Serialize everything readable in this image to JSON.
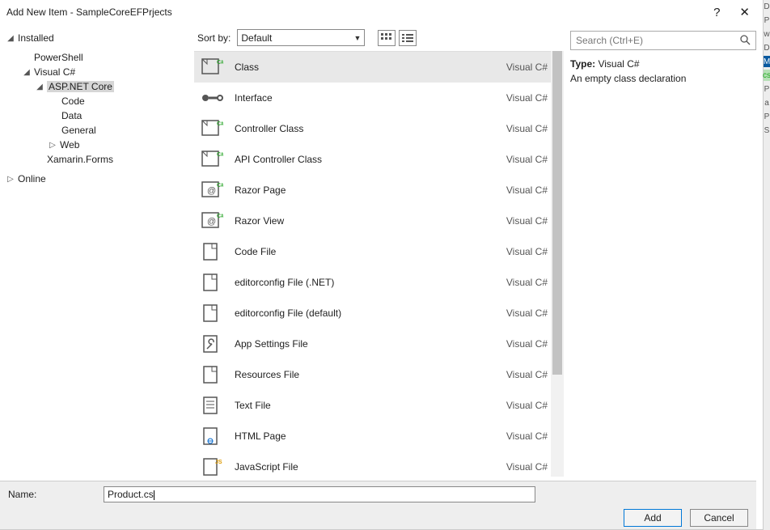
{
  "window": {
    "title": "Add New Item - SampleCoreEFPrjects",
    "help": "?",
    "close": "✕"
  },
  "tree": {
    "header": "Installed",
    "nodes": {
      "powershell": "PowerShell",
      "visualcs": "Visual C#",
      "aspnetcore": "ASP.NET Core",
      "code": "Code",
      "data": "Data",
      "general": "General",
      "web": "Web",
      "xamarin": "Xamarin.Forms",
      "online": "Online"
    }
  },
  "toolbar": {
    "sortby": "Sort by:",
    "sortvalue": "Default"
  },
  "search": {
    "placeholder": "Search (Ctrl+E)"
  },
  "templates": [
    {
      "name": "Class",
      "lang": "Visual C#",
      "selected": true
    },
    {
      "name": "Interface",
      "lang": "Visual C#"
    },
    {
      "name": "Controller Class",
      "lang": "Visual C#"
    },
    {
      "name": "API Controller Class",
      "lang": "Visual C#"
    },
    {
      "name": "Razor Page",
      "lang": "Visual C#"
    },
    {
      "name": "Razor View",
      "lang": "Visual C#"
    },
    {
      "name": "Code File",
      "lang": "Visual C#"
    },
    {
      "name": "editorconfig File (.NET)",
      "lang": "Visual C#"
    },
    {
      "name": "editorconfig File (default)",
      "lang": "Visual C#"
    },
    {
      "name": "App Settings File",
      "lang": "Visual C#"
    },
    {
      "name": "Resources File",
      "lang": "Visual C#"
    },
    {
      "name": "Text File",
      "lang": "Visual C#"
    },
    {
      "name": "HTML Page",
      "lang": "Visual C#"
    },
    {
      "name": "JavaScript File",
      "lang": "Visual C#"
    }
  ],
  "description": {
    "type_label": "Type:",
    "type_value": "Visual C#",
    "text": "An empty class declaration"
  },
  "bottom": {
    "name_label": "Name:",
    "name_value": "Product.cs",
    "add": "Add",
    "cancel": "Cancel"
  },
  "side_letters": [
    "D",
    "P",
    "w",
    "D",
    "M",
    "cs",
    "P",
    "a",
    "P",
    "S"
  ]
}
